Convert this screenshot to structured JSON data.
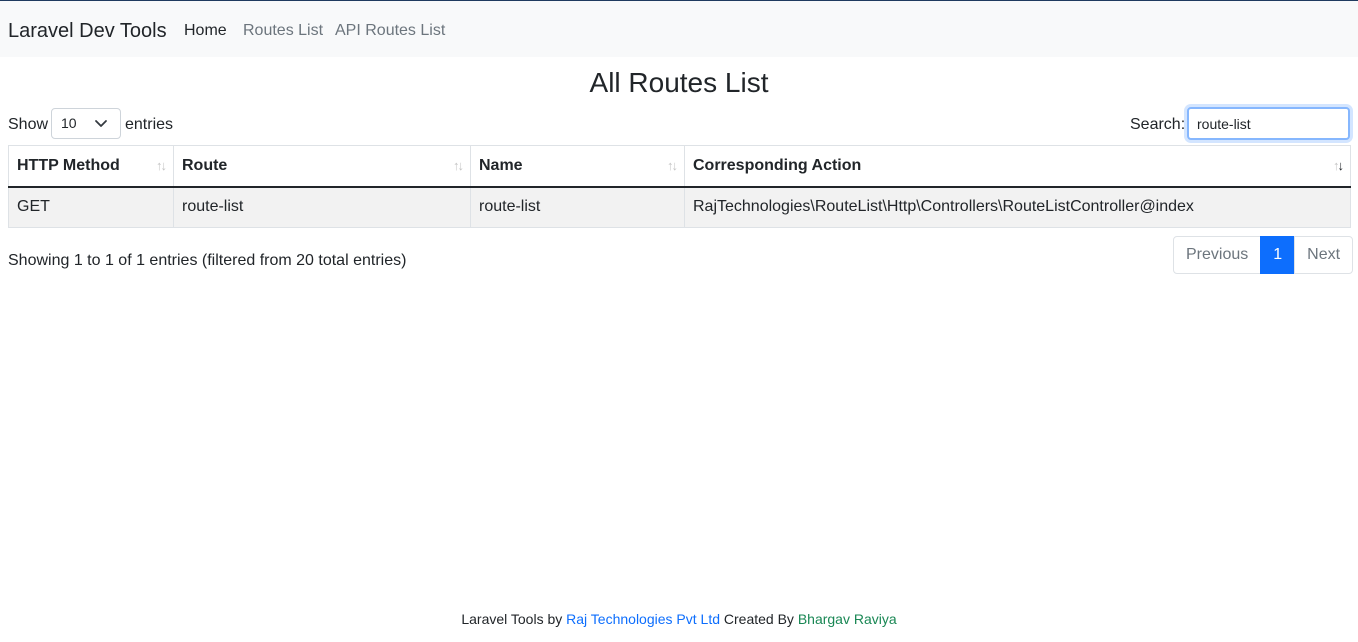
{
  "navbar": {
    "brand": "Laravel Dev Tools",
    "links": [
      {
        "label": "Home",
        "active": true
      },
      {
        "label": "Routes List",
        "active": false
      },
      {
        "label": "API Routes List",
        "active": false
      }
    ]
  },
  "page": {
    "title": "All Routes List"
  },
  "length_control": {
    "show_label": "Show",
    "selected": "10",
    "entries_label": "entries"
  },
  "search": {
    "label": "Search:",
    "value": "route-list"
  },
  "table": {
    "columns": [
      {
        "label": "HTTP Method",
        "sort": "none"
      },
      {
        "label": "Route",
        "sort": "none"
      },
      {
        "label": "Name",
        "sort": "none"
      },
      {
        "label": "Corresponding Action",
        "sort": "desc"
      }
    ],
    "rows": [
      [
        "GET",
        "route-list",
        "route-list",
        "RajTechnologies\\RouteList\\Http\\Controllers\\RouteListController@index"
      ]
    ]
  },
  "info": "Showing 1 to 1 of 1 entries (filtered from 20 total entries)",
  "pagination": {
    "previous": "Previous",
    "current": "1",
    "next": "Next"
  },
  "footer": {
    "prefix": "Laravel Tools by",
    "company": "Raj Technologies Pvt Ltd",
    "middle": "Created By",
    "author": "Bhargav Raviya"
  },
  "colors": {
    "accent": "#0d6efd",
    "author_link": "#198754",
    "navbar_bg": "#f8f9fa"
  }
}
